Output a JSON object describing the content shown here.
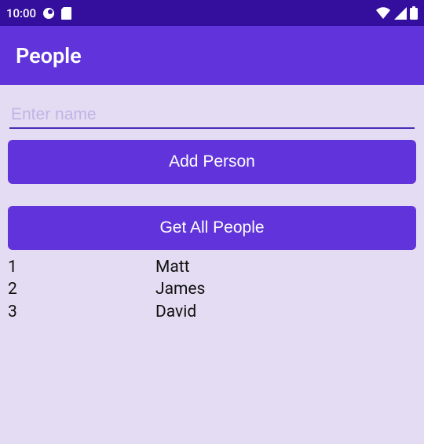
{
  "status": {
    "time": "10:00",
    "icons_left": [
      "circle-notch-icon",
      "sd-card-icon"
    ],
    "icons_right": [
      "wifi-icon",
      "signal-icon",
      "battery-icon"
    ]
  },
  "header": {
    "title": "People"
  },
  "form": {
    "name_placeholder": "Enter name",
    "name_value": "",
    "add_button_label": "Add Person",
    "get_all_button_label": "Get All People"
  },
  "people": [
    {
      "id": "1",
      "name": "Matt"
    },
    {
      "id": "2",
      "name": "James"
    },
    {
      "id": "3",
      "name": "David"
    }
  ]
}
